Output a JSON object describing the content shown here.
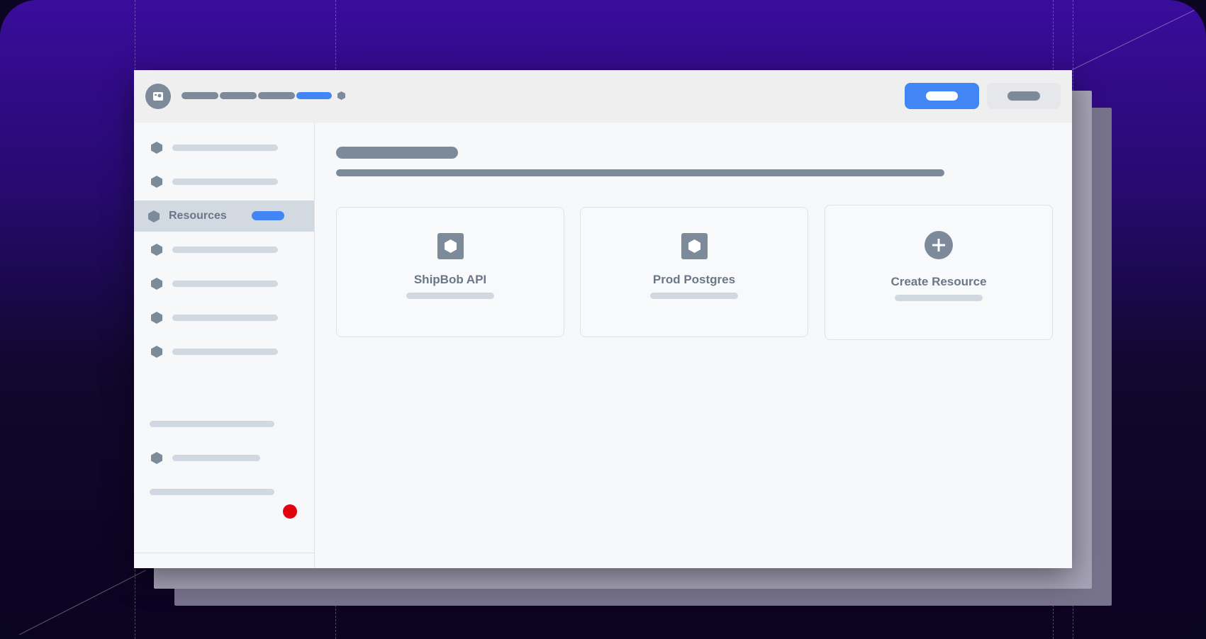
{
  "sidebar": {
    "active_item": {
      "label": "Resources",
      "icon": "hexagon-icon"
    },
    "notification_color": "#e3000f"
  },
  "main": {
    "cards": [
      {
        "title": "ShipBob API",
        "icon": "hexagon-icon"
      },
      {
        "title": "Prod Postgres",
        "icon": "hexagon-icon"
      },
      {
        "title": "Create Resource",
        "icon": "plus-circle-icon"
      }
    ]
  },
  "progress": {
    "fraction": 0.5
  },
  "colors": {
    "accent": "#4285f4",
    "placeholder_dark": "#7d8a9a",
    "placeholder_light": "#d2d8df",
    "background_top": "#3a0c9c",
    "background_bottom": "#0b0320"
  }
}
